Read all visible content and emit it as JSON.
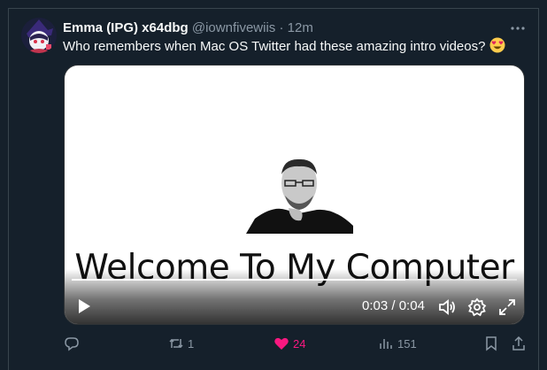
{
  "tweet": {
    "author_name": "Emma (IPG) x64dbg",
    "handle": "@iownfivewiis",
    "separator": "·",
    "time": "12m",
    "text": "Who remembers when Mac OS Twitter had these amazing intro videos?",
    "emoji": "😍",
    "more_icon": "more-icon"
  },
  "video": {
    "caption": "Welcome To My Computer",
    "current_time": "0:03",
    "time_separator": "/",
    "duration": "0:04",
    "progress": 0.75,
    "icons": [
      "play-icon",
      "volume-icon",
      "settings-icon",
      "fullscreen-icon"
    ]
  },
  "actions": {
    "reply_count": "",
    "retweet_count": "1",
    "like_count": "24",
    "views_count": "151",
    "like_color": "#f91880"
  },
  "colors": {
    "background": "#15202b",
    "text_primary": "#f7f9f9",
    "text_secondary": "#8b98a5",
    "border": "#38444d"
  }
}
